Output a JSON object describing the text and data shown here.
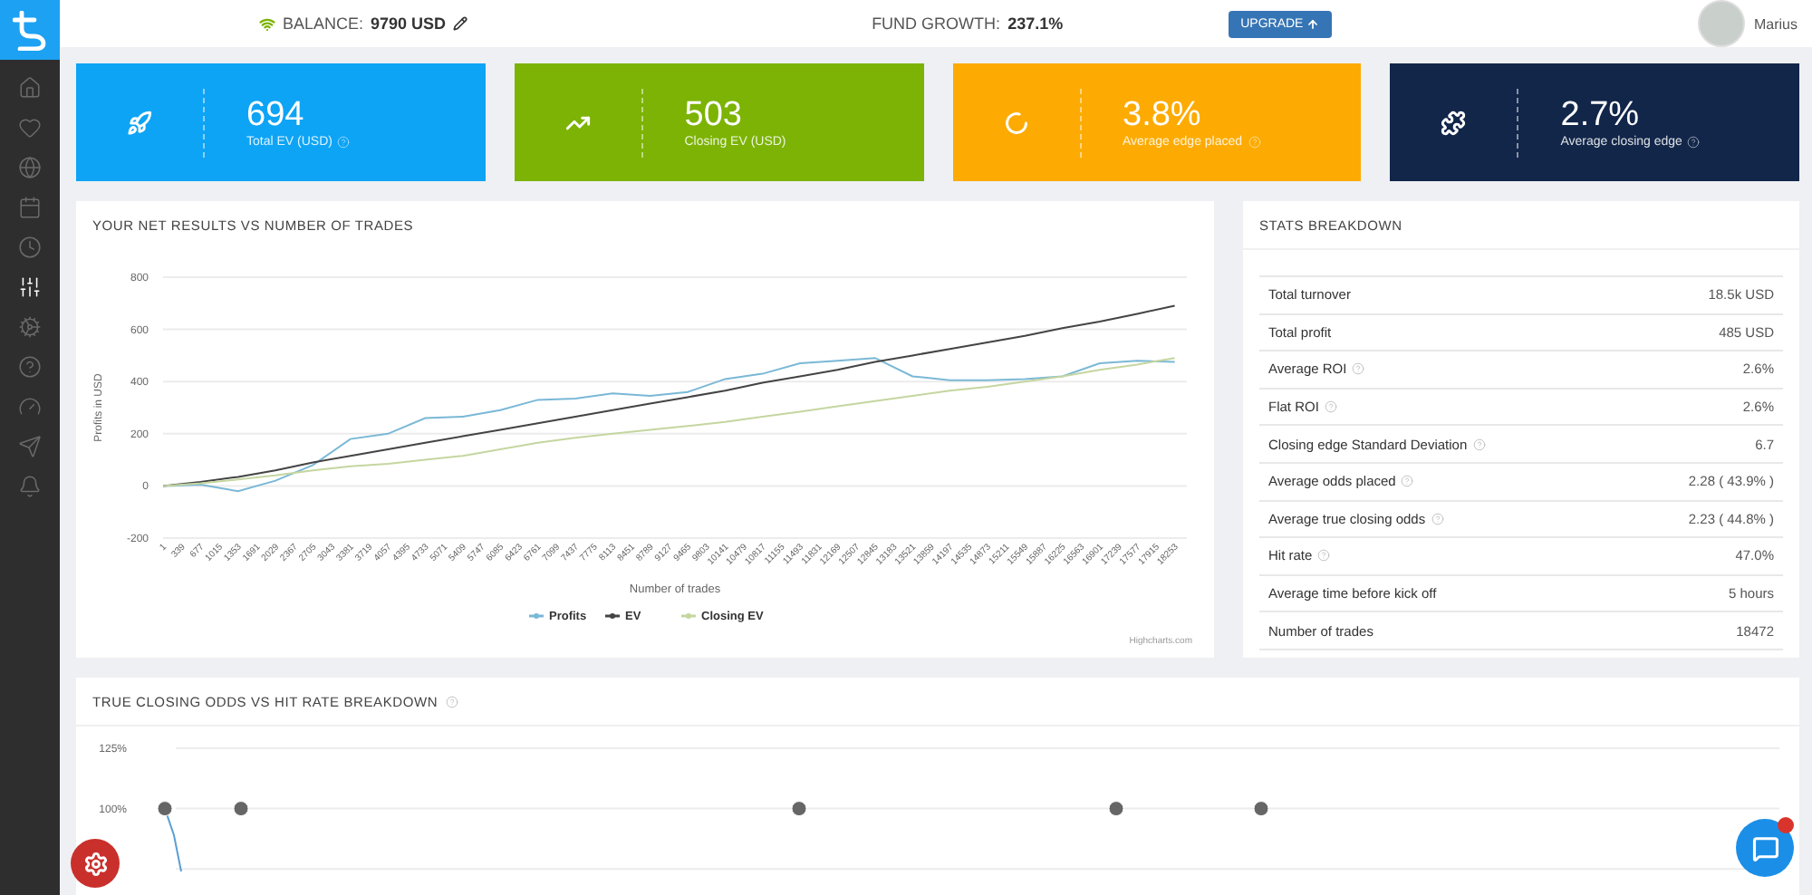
{
  "topbar": {
    "balance_label": "BALANCE:",
    "balance_value": "9790 USD",
    "fund_growth_label": "FUND GROWTH:",
    "fund_growth_value": "237.1%",
    "upgrade_button": "UPGRADE",
    "user_name": "Marius"
  },
  "sidebar": {
    "items": [
      {
        "selected": false
      },
      {
        "selected": false
      },
      {
        "selected": false
      },
      {
        "selected": false
      },
      {
        "selected": false
      },
      {
        "selected": true
      },
      {
        "selected": false
      },
      {
        "selected": false
      },
      {
        "selected": false
      },
      {
        "selected": false
      },
      {
        "selected": false
      }
    ]
  },
  "kpis": [
    {
      "color": "#0ea4f5",
      "value": "694",
      "label": "Total EV (USD)",
      "help": true
    },
    {
      "color": "#7cb305",
      "value": "503",
      "label": "Closing EV (USD)",
      "help": false
    },
    {
      "color": "#fdab03",
      "value": "3.8%",
      "label": "Average edge placed",
      "help": true
    },
    {
      "color": "#12264a",
      "value": "2.7%",
      "label": "Average closing edge",
      "help": true
    }
  ],
  "results_panel": {
    "title": "YOUR NET RESULTS VS NUMBER OF TRADES",
    "credits": "Highcharts.com",
    "chart_data": {
      "type": "line",
      "grid": true,
      "legend": true,
      "xlabel": "Number of trades",
      "ylabel": "Profits in USD",
      "ylim": [
        -200,
        800
      ],
      "yticks": [
        -200,
        0,
        200,
        400,
        600,
        800
      ],
      "xlim": [
        1,
        18472
      ],
      "xticks": [
        1,
        339,
        677,
        1015,
        1353,
        1691,
        2029,
        2367,
        2705,
        3043,
        3381,
        3719,
        4057,
        4395,
        4733,
        5071,
        5409,
        5747,
        6085,
        6423,
        6761,
        7099,
        7437,
        7775,
        8113,
        8451,
        8789,
        9127,
        9465,
        9803,
        10141,
        10479,
        10817,
        11155,
        11493,
        11831,
        12169,
        12507,
        12845,
        13183,
        13521,
        13859,
        14197,
        14535,
        14873,
        15211,
        15549,
        15887,
        16225,
        16563,
        16901,
        17239,
        17577,
        17915,
        18253
      ],
      "x": [
        1,
        677,
        1353,
        2029,
        2705,
        3381,
        4057,
        4733,
        5409,
        6085,
        6761,
        7437,
        8113,
        8789,
        9465,
        10141,
        10817,
        11493,
        12169,
        12845,
        13521,
        14197,
        14873,
        15549,
        16225,
        16901,
        17577,
        18253
      ],
      "series": [
        {
          "name": "Profits",
          "color": "#7ab8d6",
          "values": [
            0,
            5,
            -20,
            20,
            80,
            180,
            200,
            260,
            265,
            290,
            330,
            335,
            355,
            345,
            360,
            410,
            430,
            470,
            480,
            490,
            420,
            405,
            405,
            410,
            420,
            470,
            480,
            475
          ]
        },
        {
          "name": "EV",
          "color": "#444444",
          "values": [
            0,
            15,
            35,
            60,
            90,
            115,
            140,
            165,
            190,
            215,
            240,
            265,
            290,
            315,
            340,
            365,
            395,
            420,
            445,
            475,
            500,
            525,
            550,
            575,
            605,
            630,
            660,
            690
          ]
        },
        {
          "name": "Closing EV",
          "color": "#c5d6a0",
          "values": [
            0,
            10,
            25,
            40,
            60,
            75,
            85,
            100,
            115,
            140,
            165,
            185,
            200,
            215,
            230,
            245,
            265,
            285,
            305,
            325,
            345,
            365,
            380,
            400,
            420,
            445,
            465,
            490
          ]
        }
      ]
    }
  },
  "stats_panel": {
    "title": "STATS BREAKDOWN",
    "rows": [
      {
        "label": "Total turnover",
        "value": "18.5k USD",
        "help": false
      },
      {
        "label": "Total profit",
        "value": "485 USD",
        "help": false
      },
      {
        "label": "Average ROI",
        "value": "2.6%",
        "help": true
      },
      {
        "label": "Flat ROI",
        "value": "2.6%",
        "help": true
      },
      {
        "label": "Closing edge Standard Deviation",
        "value": "6.7",
        "help": true
      },
      {
        "label": "Average odds placed",
        "value": "2.28 ( 43.9% )",
        "help": true
      },
      {
        "label": "Average true closing odds",
        "value": "2.23 ( 44.8% )",
        "help": true
      },
      {
        "label": "Hit rate",
        "value": "47.0%",
        "help": true
      },
      {
        "label": "Average time before kick off",
        "value": "5 hours",
        "help": false
      },
      {
        "label": "Number of trades",
        "value": "18472",
        "help": false
      }
    ]
  },
  "breakdown_panel": {
    "title": "TRUE CLOSING ODDS VS HIT RATE BREAKDOWN",
    "help": true,
    "axis_labels": [
      "125%",
      "100%"
    ]
  },
  "chat": {
    "badge": true
  }
}
